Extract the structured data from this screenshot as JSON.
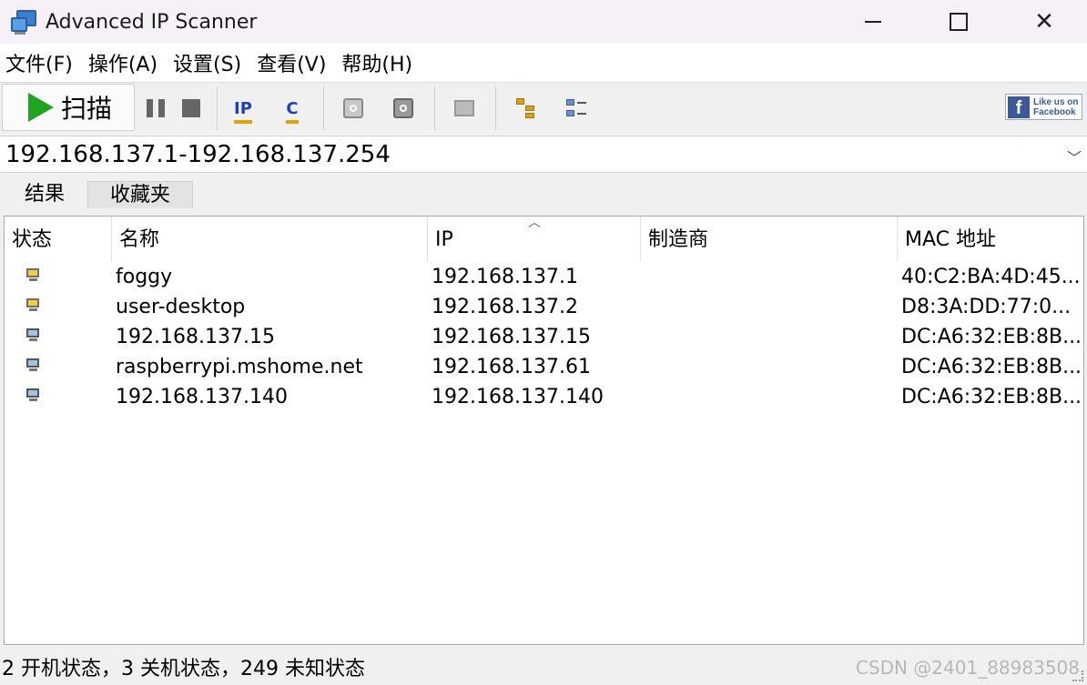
{
  "window": {
    "title": "Advanced IP Scanner"
  },
  "menu": [
    "文件(F)",
    "操作(A)",
    "设置(S)",
    "查看(V)",
    "帮助(H)"
  ],
  "toolbar": {
    "scan_label": "扫描",
    "ip_label": "IP",
    "c_label": "C",
    "facebook_line1": "Like us on",
    "facebook_line2": "Facebook",
    "facebook_logo": "f"
  },
  "address": {
    "value": "192.168.137.1-192.168.137.254"
  },
  "tabs": [
    "结果",
    "收藏夹"
  ],
  "table": {
    "columns": [
      "状态",
      "名称",
      "IP",
      "制造商",
      "MAC 地址"
    ],
    "rows": [
      {
        "status": "on",
        "name": "foggy",
        "ip": "192.168.137.1",
        "vendor": "",
        "mac": "40:C2:BA:4D:45..."
      },
      {
        "status": "on",
        "name": "user-desktop",
        "ip": "192.168.137.2",
        "vendor": "",
        "mac": "D8:3A:DD:77:0..."
      },
      {
        "status": "off",
        "name": "192.168.137.15",
        "ip": "192.168.137.15",
        "vendor": "",
        "mac": "DC:A6:32:EB:8B..."
      },
      {
        "status": "off",
        "name": "raspberrypi.mshome.net",
        "ip": "192.168.137.61",
        "vendor": "",
        "mac": "DC:A6:32:EB:8B..."
      },
      {
        "status": "off",
        "name": "192.168.137.140",
        "ip": "192.168.137.140",
        "vendor": "",
        "mac": "DC:A6:32:EB:8B..."
      }
    ]
  },
  "status": {
    "text": "2 开机状态，3 关机状态，249 未知状态"
  },
  "watermark": "CSDN @2401_88983508"
}
